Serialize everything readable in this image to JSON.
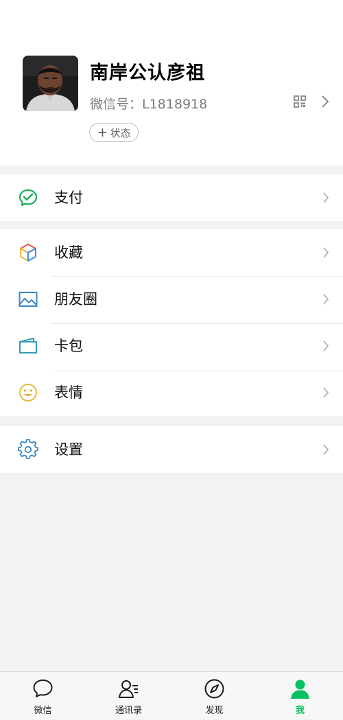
{
  "profile": {
    "nickname": "南岸公认彦祖",
    "wechat_id": "微信号：L1818918",
    "status_label": "状态"
  },
  "menu": {
    "pay": {
      "label": "支付",
      "icon": "wechat-pay-icon"
    },
    "favorites": {
      "label": "收藏",
      "icon": "cube-icon"
    },
    "moments": {
      "label": "朋友圈",
      "icon": "picture-icon"
    },
    "cards": {
      "label": "卡包",
      "icon": "card-wallet-icon"
    },
    "stickers": {
      "label": "表情",
      "icon": "smiley-icon"
    },
    "settings": {
      "label": "设置",
      "icon": "gear-icon"
    }
  },
  "tabbar": {
    "active_color": "#07c160",
    "tabs": [
      {
        "label": "微信",
        "icon": "chat-bubble-icon"
      },
      {
        "label": "通讯录",
        "icon": "contacts-icon"
      },
      {
        "label": "发现",
        "icon": "compass-icon"
      },
      {
        "label": "我",
        "icon": "person-icon",
        "active": true
      }
    ]
  }
}
